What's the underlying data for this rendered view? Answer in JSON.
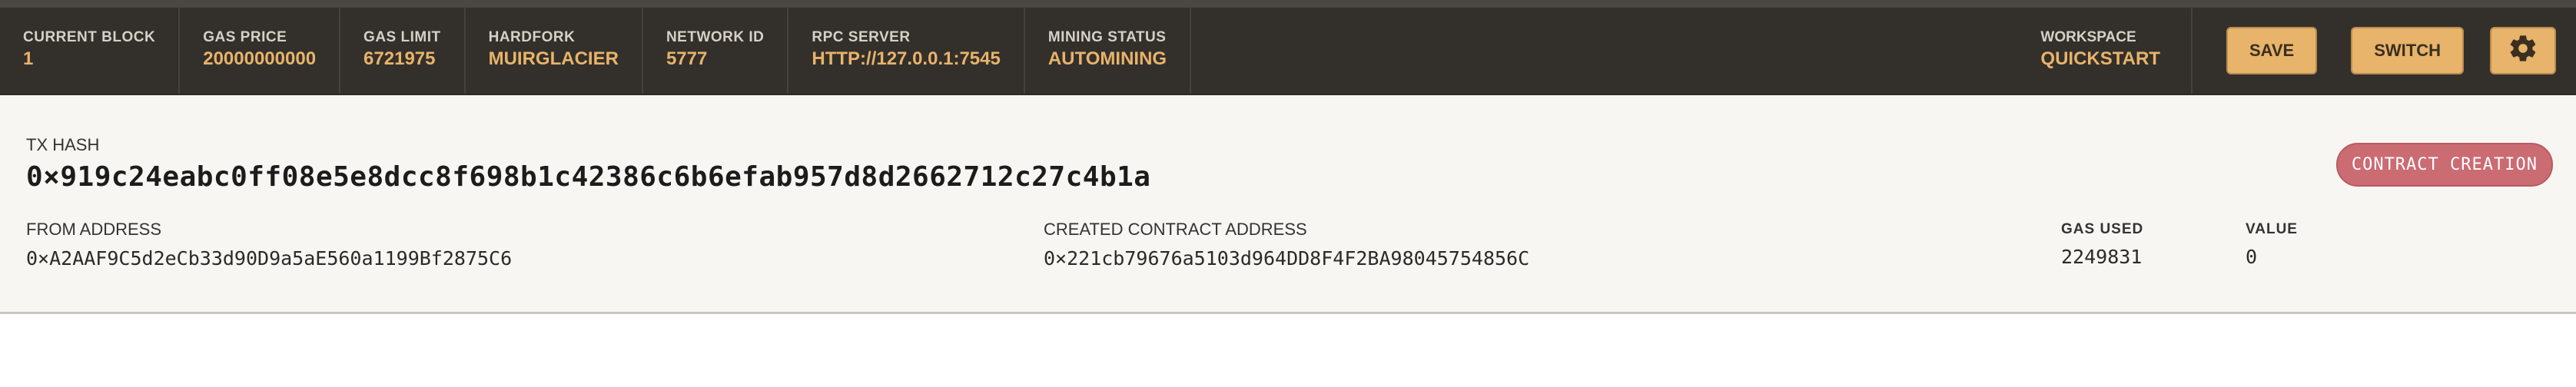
{
  "status": {
    "items": [
      {
        "label": "CURRENT BLOCK",
        "value": "1"
      },
      {
        "label": "GAS PRICE",
        "value": "20000000000"
      },
      {
        "label": "GAS LIMIT",
        "value": "6721975"
      },
      {
        "label": "HARDFORK",
        "value": "MUIRGLACIER"
      },
      {
        "label": "NETWORK ID",
        "value": "5777"
      },
      {
        "label": "RPC SERVER",
        "value": "HTTP://127.0.0.1:7545"
      },
      {
        "label": "MINING STATUS",
        "value": "AUTOMINING"
      }
    ],
    "workspace": {
      "label": "WORKSPACE",
      "value": "QUICKSTART"
    },
    "save_label": "SAVE",
    "switch_label": "SWITCH",
    "settings_icon": "gear-icon"
  },
  "tx": {
    "hash_label": "TX HASH",
    "hash": "0×919c24eabc0ff08e5e8dcc8f698b1c42386c6b6efab957d8d2662712c27c4b1a",
    "type_badge": "CONTRACT CREATION",
    "from_label": "FROM ADDRESS",
    "from": "0×A2AAF9C5d2eCb33d90D9a5aE560a1199Bf2875C6",
    "contract_label": "CREATED CONTRACT ADDRESS",
    "contract": "0×221cb79676a5103d964DD8F4F2BA98045754856C",
    "gas_used_label": "GAS USED",
    "gas_used": "2249831",
    "value_label": "VALUE",
    "value": "0"
  },
  "colors": {
    "header_bg": "#33302b",
    "accent": "#e8b36a",
    "badge": "#cb6b72"
  }
}
